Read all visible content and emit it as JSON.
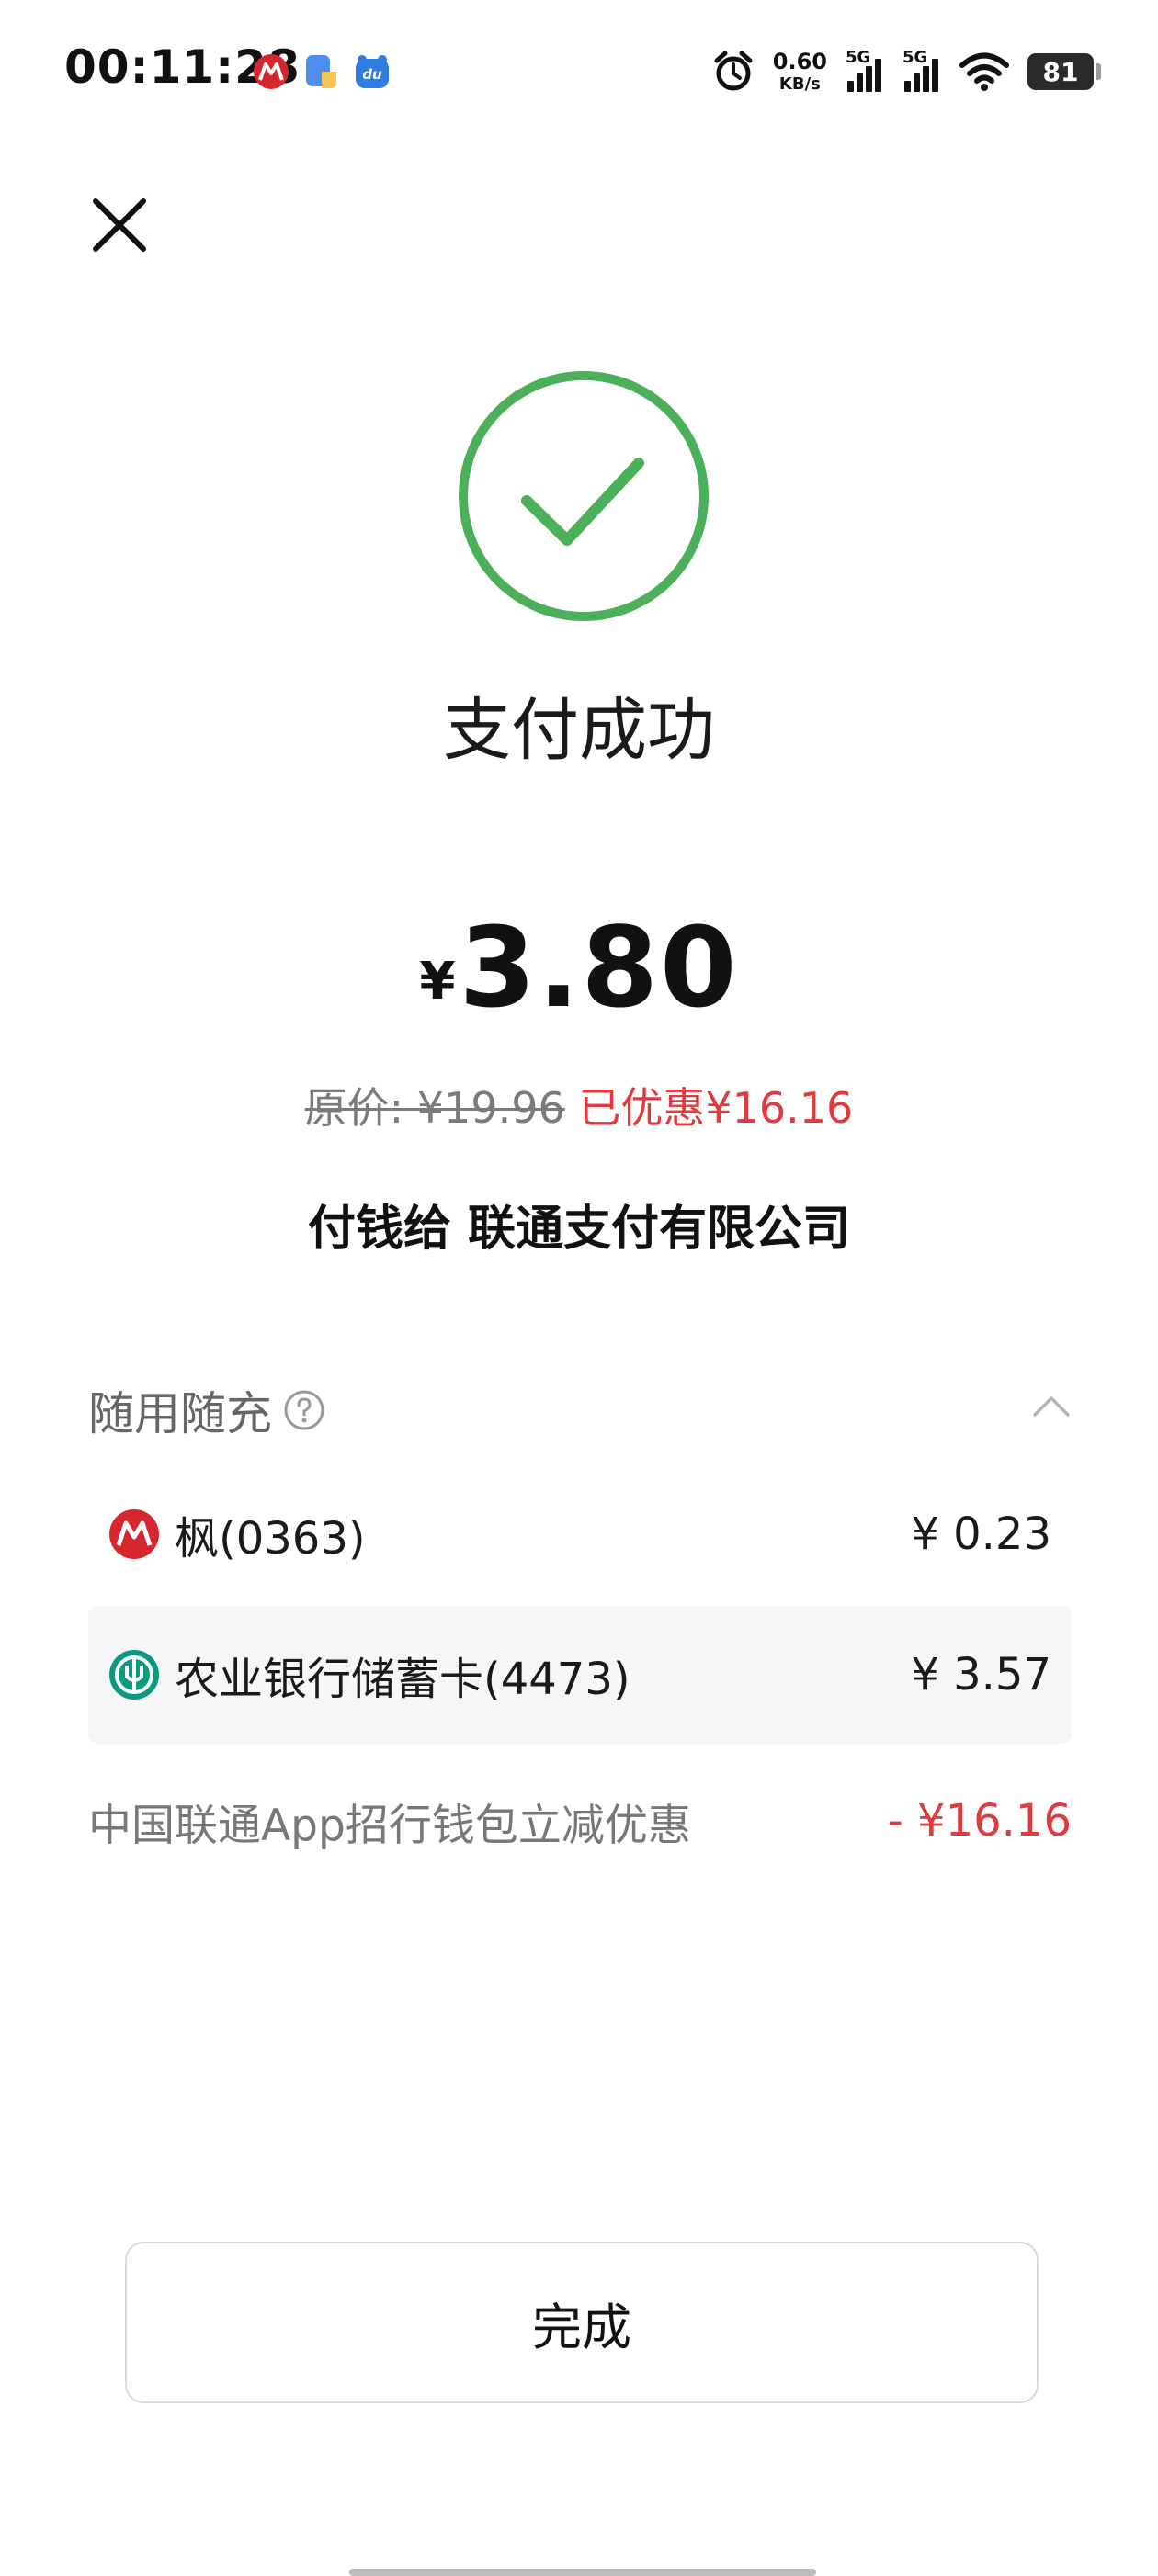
{
  "status_bar": {
    "time": "00:11:28",
    "net_speed_value": "0.60",
    "net_speed_unit": "KB/s",
    "signal_1_label": "5G",
    "signal_2_label": "5G",
    "battery_level": "81",
    "app_icons": [
      "cmb-app-icon",
      "wallet-app-icon",
      "du-app-icon"
    ]
  },
  "header": {
    "close_icon": "close-icon"
  },
  "result": {
    "status_icon": "check-circle-icon",
    "status_color": "#4caf5a",
    "title": "支付成功"
  },
  "amount": {
    "currency": "¥",
    "value": "3.80",
    "original_price": "原价: ¥19.96",
    "saved": "已优惠¥16.16",
    "saved_color": "#e0393e"
  },
  "payee": {
    "text": "付钱给 联通支付有限公司"
  },
  "payment_breakdown": {
    "title": "随用随充",
    "help_icon": "help-circle-icon",
    "collapse_icon": "chevron-up-icon",
    "methods": [
      {
        "icon": "cmb-bank-logo",
        "label": "枫(0363)",
        "amount": "¥ 0.23"
      },
      {
        "icon": "abc-bank-logo",
        "label": "农业银行储蓄卡(4473)",
        "amount": "¥ 3.57"
      }
    ],
    "promotion": {
      "label": "中国联通App招行钱包立减优惠",
      "amount": "- ¥16.16"
    }
  },
  "actions": {
    "done_label": "完成"
  }
}
